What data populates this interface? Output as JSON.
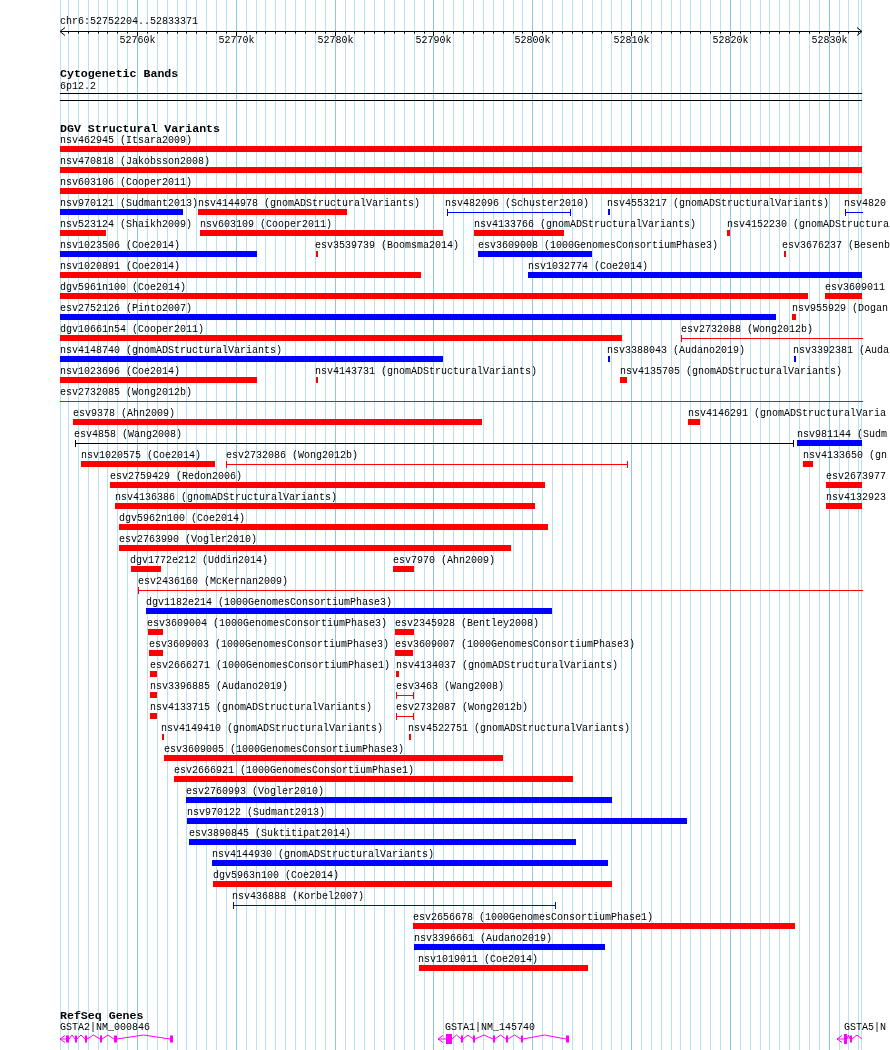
{
  "ruler": {
    "region": "chr6:52752204..52833371",
    "ticks": [
      "52760k",
      "52770k",
      "52780k",
      "52790k",
      "52800k",
      "52810k",
      "52820k",
      "52830k"
    ]
  },
  "tracks": [
    {
      "kind": "cytoband",
      "title": "Cytogenetic Bands",
      "band": "6p12.2"
    },
    {
      "kind": "variants",
      "title": "DGV Structural Variants",
      "rows": [
        {
          "features": [
            {
              "label": "nsv462945 (Itsara2009)",
              "kind": "bar",
              "color": "#ff0000"
            }
          ]
        },
        {
          "features": [
            {
              "label": "nsv470818 (Jakobsson2008)",
              "kind": "bar",
              "color": "#ff0000"
            }
          ]
        },
        {
          "features": [
            {
              "label": "nsv603106 (Cooper2011)",
              "kind": "bar",
              "color": "#ff0000"
            }
          ]
        },
        {
          "features": [
            {
              "label": "nsv970121 (Sudmant2013)",
              "kind": "bar",
              "color": "#0000ff"
            },
            {
              "label": "nsv4144978 (gnomADStructuralVariants)",
              "kind": "bar",
              "color": "#ff0000"
            },
            {
              "label": "nsv482096 (Schuster2010)",
              "kind": "span",
              "color": "#0000ff"
            },
            {
              "label": "nsv4553217 (gnomADStructuralVariants)",
              "kind": "bar",
              "color": "#0000ff"
            },
            {
              "label": "nsv4820",
              "kind": "span",
              "color": "#0000ff"
            }
          ]
        },
        {
          "features": [
            {
              "label": "nsv523124 (Shaikh2009)",
              "kind": "bar",
              "color": "#ff0000"
            },
            {
              "label": "nsv603109 (Cooper2011)",
              "kind": "bar",
              "color": "#ff0000"
            },
            {
              "label": "nsv4133766 (gnomADStructuralVariants)",
              "kind": "bar",
              "color": "#ff0000"
            },
            {
              "label": "nsv4152230 (gnomADStructura",
              "kind": "bar",
              "color": "#ff0000"
            }
          ]
        },
        {
          "features": [
            {
              "label": "nsv1023506 (Coe2014)",
              "kind": "bar",
              "color": "#0000ff"
            },
            {
              "label": "esv3539739 (Boomsma2014)",
              "kind": "bar",
              "color": "#ff0000"
            },
            {
              "label": "esv3609008 (1000GenomesConsortiumPhase3)",
              "kind": "bar",
              "color": "#0000ff"
            },
            {
              "label": "esv3676237 (Besenb",
              "kind": "bar",
              "color": "#ff0000"
            }
          ]
        },
        {
          "features": [
            {
              "label": "nsv1020891 (Coe2014)",
              "kind": "bar",
              "color": "#ff0000"
            },
            {
              "label": "nsv1032774 (Coe2014)",
              "kind": "bar",
              "color": "#0000ff"
            }
          ]
        },
        {
          "features": [
            {
              "label": "dgv5961n100 (Coe2014)",
              "kind": "bar",
              "color": "#ff0000"
            },
            {
              "label": "esv3609011",
              "kind": "bar",
              "color": "#ff0000"
            }
          ]
        },
        {
          "features": [
            {
              "label": "esv2752126 (Pinto2007)",
              "kind": "bar",
              "color": "#0000ff"
            },
            {
              "label": "nsv955929 (Dogan",
              "kind": "bar",
              "color": "#ff0000"
            }
          ]
        },
        {
          "features": [
            {
              "label": "dgv10661n54 (Cooper2011)",
              "kind": "bar",
              "color": "#ff0000"
            },
            {
              "label": "esv2732088 (Wong2012b)",
              "kind": "span",
              "color": "#ff0000"
            }
          ]
        },
        {
          "features": [
            {
              "label": "nsv4148740 (gnomADStructuralVariants)",
              "kind": "bar",
              "color": "#0000ff"
            },
            {
              "label": "nsv3388043 (Audano2019)",
              "kind": "bar",
              "color": "#0000ff"
            },
            {
              "label": "nsv3392381 (Auda",
              "kind": "bar",
              "color": "#0000ff"
            }
          ]
        },
        {
          "features": [
            {
              "label": "nsv1023696 (Coe2014)",
              "kind": "bar",
              "color": "#ff0000"
            },
            {
              "label": "nsv4143731 (gnomADStructuralVariants)",
              "kind": "bar",
              "color": "#ff0000"
            },
            {
              "label": "nsv4135705 (gnomADStructuralVariants)",
              "kind": "bar",
              "color": "#ff0000"
            }
          ]
        },
        {
          "features": [
            {
              "label": "esv2732085 (Wong2012b)",
              "kind": "span",
              "color": "#ff0000"
            }
          ]
        },
        {
          "features": [
            {
              "label": "esv9378 (Ahn2009)",
              "kind": "bar",
              "color": "#ff0000"
            },
            {
              "label": "nsv4146291 (gnomADStructuralVaria",
              "kind": "bar",
              "color": "#ff0000"
            }
          ]
        },
        {
          "features": [
            {
              "label": "esv4858 (Wang2008)",
              "kind": "span",
              "color": "#000000"
            },
            {
              "label": "nsv981144 (Sudm",
              "kind": "bar",
              "color": "#0000ff"
            }
          ]
        },
        {
          "features": [
            {
              "label": "nsv1020575 (Coe2014)",
              "kind": "bar",
              "color": "#ff0000"
            },
            {
              "label": "esv2732086 (Wong2012b)",
              "kind": "span",
              "color": "#ff0000"
            },
            {
              "label": "nsv4133650 (gn",
              "kind": "bar",
              "color": "#ff0000"
            }
          ]
        },
        {
          "features": [
            {
              "label": "esv2759429 (Redon2006)",
              "kind": "bar",
              "color": "#ff0000"
            },
            {
              "label": "esv2673977",
              "kind": "bar",
              "color": "#ff0000"
            }
          ]
        },
        {
          "features": [
            {
              "label": "nsv4136386 (gnomADStructuralVariants)",
              "kind": "bar",
              "color": "#ff0000"
            },
            {
              "label": "nsv4132923",
              "kind": "bar",
              "color": "#ff0000"
            }
          ]
        },
        {
          "features": [
            {
              "label": "dgv5962n100 (Coe2014)",
              "kind": "bar",
              "color": "#ff0000"
            }
          ]
        },
        {
          "features": [
            {
              "label": "esv2763990 (Vogler2010)",
              "kind": "bar",
              "color": "#ff0000"
            }
          ]
        },
        {
          "features": [
            {
              "label": "dgv1772e212 (Uddin2014)",
              "kind": "bar",
              "color": "#ff0000"
            },
            {
              "label": "esv7970 (Ahn2009)",
              "kind": "bar",
              "color": "#ff0000"
            }
          ]
        },
        {
          "features": [
            {
              "label": "esv2436160 (McKernan2009)",
              "kind": "span",
              "color": "#ff0000"
            }
          ]
        },
        {
          "features": [
            {
              "label": "dgv1182e214 (1000GenomesConsortiumPhase3)",
              "kind": "bar",
              "color": "#0000ff"
            }
          ]
        },
        {
          "features": [
            {
              "label": "esv3609004 (1000GenomesConsortiumPhase3)",
              "kind": "bar",
              "color": "#ff0000"
            },
            {
              "label": "esv2345928 (Bentley2008)",
              "kind": "bar",
              "color": "#ff0000"
            }
          ]
        },
        {
          "features": [
            {
              "label": "esv3609003 (1000GenomesConsortiumPhase3)",
              "kind": "bar",
              "color": "#ff0000"
            },
            {
              "label": "esv3609007 (1000GenomesConsortiumPhase3)",
              "kind": "bar",
              "color": "#ff0000"
            }
          ]
        },
        {
          "features": [
            {
              "label": "esv2666271 (1000GenomesConsortiumPhase1)",
              "kind": "bar",
              "color": "#ff0000"
            },
            {
              "label": "nsv4134037 (gnomADStructuralVariants)",
              "kind": "bar",
              "color": "#ff0000"
            }
          ]
        },
        {
          "features": [
            {
              "label": "nsv3396885 (Audano2019)",
              "kind": "bar",
              "color": "#ff0000"
            },
            {
              "label": "esv3463 (Wang2008)",
              "kind": "span",
              "color": "#ff0000"
            }
          ]
        },
        {
          "features": [
            {
              "label": "nsv4133715 (gnomADStructuralVariants)",
              "kind": "bar",
              "color": "#ff0000"
            },
            {
              "label": "esv2732087 (Wong2012b)",
              "kind": "span",
              "color": "#ff0000"
            }
          ]
        },
        {
          "features": [
            {
              "label": "nsv4149410 (gnomADStructuralVariants)",
              "kind": "bar",
              "color": "#ff0000"
            },
            {
              "label": "nsv4522751 (gnomADStructuralVariants)",
              "kind": "bar",
              "color": "#ff0000"
            }
          ]
        },
        {
          "features": [
            {
              "label": "esv3609005 (1000GenomesConsortiumPhase3)",
              "kind": "bar",
              "color": "#ff0000"
            }
          ]
        },
        {
          "features": [
            {
              "label": "esv2666921 (1000GenomesConsortiumPhase1)",
              "kind": "bar",
              "color": "#ff0000"
            }
          ]
        },
        {
          "features": [
            {
              "label": "esv2760993 (Vogler2010)",
              "kind": "bar",
              "color": "#0000ff"
            }
          ]
        },
        {
          "features": [
            {
              "label": "nsv970122 (Sudmant2013)",
              "kind": "bar",
              "color": "#0000ff"
            }
          ]
        },
        {
          "features": [
            {
              "label": "esv3890845 (Suktitipat2014)",
              "kind": "bar",
              "color": "#0000ff"
            }
          ]
        },
        {
          "features": [
            {
              "label": "nsv4144930 (gnomADStructuralVariants)",
              "kind": "bar",
              "color": "#0000ff"
            }
          ]
        },
        {
          "features": [
            {
              "label": "dgv5963n100 (Coe2014)",
              "kind": "bar",
              "color": "#ff0000"
            }
          ]
        },
        {
          "features": [
            {
              "label": "nsv436888 (Korbel2007)",
              "kind": "span",
              "color": "#0000ff"
            }
          ]
        },
        {
          "features": [
            {
              "label": "esv2656678 (1000GenomesConsortiumPhase1)",
              "kind": "bar",
              "color": "#ff0000"
            }
          ]
        },
        {
          "features": [
            {
              "label": "nsv3396661 (Audano2019)",
              "kind": "bar",
              "color": "#0000ff"
            }
          ]
        },
        {
          "features": [
            {
              "label": "nsv1019011 (Coe2014)",
              "kind": "bar",
              "color": "#ff0000"
            }
          ]
        }
      ]
    },
    {
      "kind": "genes",
      "title": "RefSeq Genes",
      "genes": [
        {
          "label": "GSTA2|NM_000846"
        },
        {
          "label": "GSTA1|NM_145740"
        },
        {
          "label": "GSTA5|N"
        }
      ]
    }
  ]
}
